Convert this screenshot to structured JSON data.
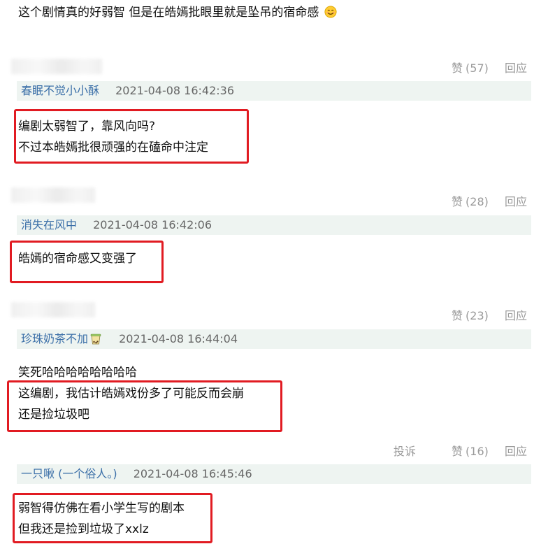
{
  "post": {
    "text": "这个剧情真的好弱智 但是在皓嫣批眼里就是坠吊的宿命感",
    "emoji": "smiling-face-icon"
  },
  "comments": [
    {
      "like_label": "赞",
      "like_count": "(57)",
      "reply_label": "回应",
      "user": "春眠不觉小小酥",
      "time": "2021-04-08 16:42:36",
      "lines": [
        "编剧太弱智了，靠风向吗?",
        "不过本皓嫣批很顽强的在磕命中注定"
      ]
    },
    {
      "like_label": "赞",
      "like_count": "(28)",
      "reply_label": "回应",
      "user": "消失在风中",
      "time": "2021-04-08 16:42:06",
      "lines": [
        "皓嫣的宿命感又变强了"
      ]
    },
    {
      "like_label": "赞",
      "like_count": "(23)",
      "reply_label": "回应",
      "user": "珍珠奶茶不加",
      "user_icon": "bubble-tea-icon",
      "time": "2021-04-08 16:44:04",
      "lines": [
        "笑死哈哈哈哈哈哈哈哈",
        "这编剧，我估计皓嫣戏份多了可能反而会崩",
        "还是捡垃圾吧"
      ]
    },
    {
      "report_label": "投诉",
      "like_label": "赞",
      "like_count": "(16)",
      "reply_label": "回应",
      "user": "一只啾",
      "user_extra": " (一个俗人。)",
      "time": "2021-04-08 16:45:46",
      "lines": [
        "弱智得仿佛在看小学生写的剧本",
        "但我还是捡到垃圾了xxlz"
      ]
    }
  ],
  "colors": {
    "highlight_box": "#e11b22",
    "username": "#3b6fa8",
    "meta_bg": "#eef4f1"
  }
}
